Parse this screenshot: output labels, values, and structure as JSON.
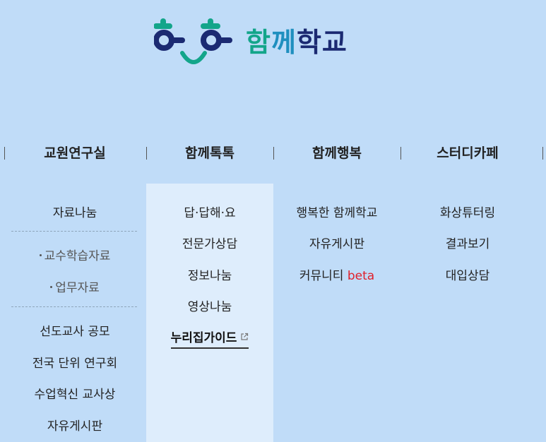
{
  "logo": {
    "text_part1": "함",
    "text_part2": "께",
    "text_part3": "학교",
    "colors": {
      "green": "#13a58a",
      "blue": "#1f8fbf",
      "navy": "#1b2a72"
    }
  },
  "gnb": {
    "items": [
      {
        "label": "교원연구실"
      },
      {
        "label": "함께톡톡"
      },
      {
        "label": "함께행복"
      },
      {
        "label": "스터디카페"
      }
    ]
  },
  "menus": {
    "research_room": {
      "item_archive": "자료나눔",
      "sub_teaching": "교수학습자료",
      "sub_work": "업무자료",
      "item_leading_teacher": "선도교사 공모",
      "item_national_unit": "전국 단위 연구회",
      "item_class_innovation": "수업혁신 교사상",
      "item_free_board": "자유게시판"
    },
    "talktalk": {
      "item_qna": "답·답해·요",
      "item_expert": "전문가상담",
      "item_info": "정보나눔",
      "item_video": "영상나눔",
      "item_guide": "누리집가이드"
    },
    "happiness": {
      "item_happy_school": "행복한 함께학교",
      "item_free_board": "자유게시판",
      "item_community": "커뮤니티",
      "beta_label": "beta"
    },
    "study_cafe": {
      "item_video_tutoring": "화상튜터링",
      "item_results": "결과보기",
      "item_admission": "대입상담"
    }
  }
}
